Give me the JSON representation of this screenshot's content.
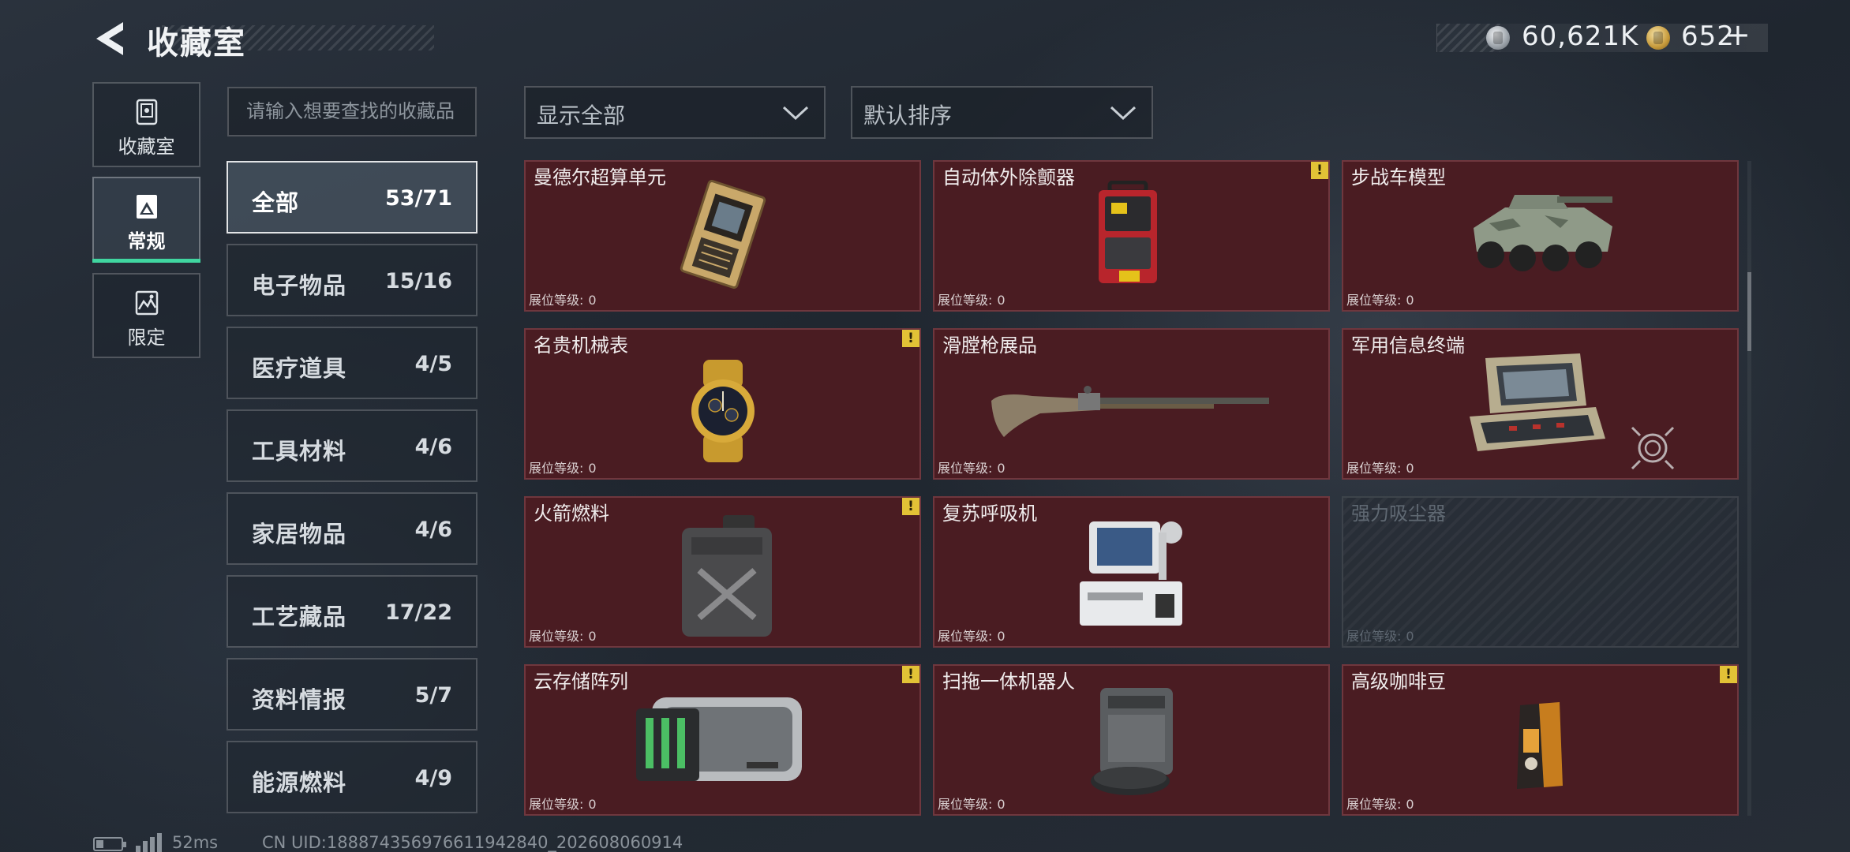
{
  "header": {
    "title": "收藏室",
    "currency_silver": "60,621K",
    "currency_gold": "652",
    "currency_plus": "+"
  },
  "left_tabs": [
    {
      "label": "收藏室",
      "icon": "vault-icon",
      "active": false
    },
    {
      "label": "常规",
      "icon": "gallery-icon",
      "active": true
    },
    {
      "label": "限定",
      "icon": "limited-icon",
      "active": false
    }
  ],
  "search": {
    "placeholder": "请输入想要查找的收藏品",
    "value": ""
  },
  "filter_dropdown": {
    "selected": "显示全部"
  },
  "sort_dropdown": {
    "selected": "默认排序"
  },
  "categories": [
    {
      "name": "全部",
      "count": "53/71",
      "active": true
    },
    {
      "name": "电子物品",
      "count": "15/16",
      "active": false
    },
    {
      "name": "医疗道具",
      "count": "4/5",
      "active": false
    },
    {
      "name": "工具材料",
      "count": "4/6",
      "active": false
    },
    {
      "name": "家居物品",
      "count": "4/6",
      "active": false
    },
    {
      "name": "工艺藏品",
      "count": "17/22",
      "active": false
    },
    {
      "name": "资料情报",
      "count": "5/7",
      "active": false
    },
    {
      "name": "能源燃料",
      "count": "4/9",
      "active": false
    }
  ],
  "level_label": "展位等级:",
  "warn_glyph": "!",
  "items": [
    {
      "name": "曼德尔超算单元",
      "level": "0",
      "warn": false,
      "locked": false,
      "art": "supercomputer-unit-image"
    },
    {
      "name": "自动体外除颤器",
      "level": "0",
      "warn": true,
      "locked": false,
      "art": "defibrillator-image"
    },
    {
      "name": "步战车模型",
      "level": "0",
      "warn": false,
      "locked": false,
      "art": "ifv-model-image"
    },
    {
      "name": "名贵机械表",
      "level": "0",
      "warn": true,
      "locked": false,
      "art": "watch-image"
    },
    {
      "name": "滑膛枪展品",
      "level": "0",
      "warn": false,
      "locked": false,
      "art": "musket-image"
    },
    {
      "name": "军用信息终端",
      "level": "0",
      "warn": false,
      "locked": false,
      "art": "military-terminal-image"
    },
    {
      "name": "火箭燃料",
      "level": "0",
      "warn": true,
      "locked": false,
      "art": "fuel-can-image"
    },
    {
      "name": "复苏呼吸机",
      "level": "0",
      "warn": false,
      "locked": false,
      "art": "ventilator-image"
    },
    {
      "name": "强力吸尘器",
      "level": "0",
      "warn": false,
      "locked": true,
      "art": "vacuum-image"
    },
    {
      "name": "云存储阵列",
      "level": "0",
      "warn": true,
      "locked": false,
      "art": "storage-array-image"
    },
    {
      "name": "扫拖一体机器人",
      "level": "0",
      "warn": false,
      "locked": false,
      "art": "robot-vacuum-image"
    },
    {
      "name": "高级咖啡豆",
      "level": "0",
      "warn": true,
      "locked": false,
      "art": "coffee-bag-image"
    }
  ],
  "footer": {
    "ping": "52ms",
    "uid": "CN UID:1888743569766119428​40_202608060914"
  },
  "colors": {
    "accent": "#40d6a0",
    "card_bg": "#4a1c22",
    "warn": "#e2c236"
  }
}
